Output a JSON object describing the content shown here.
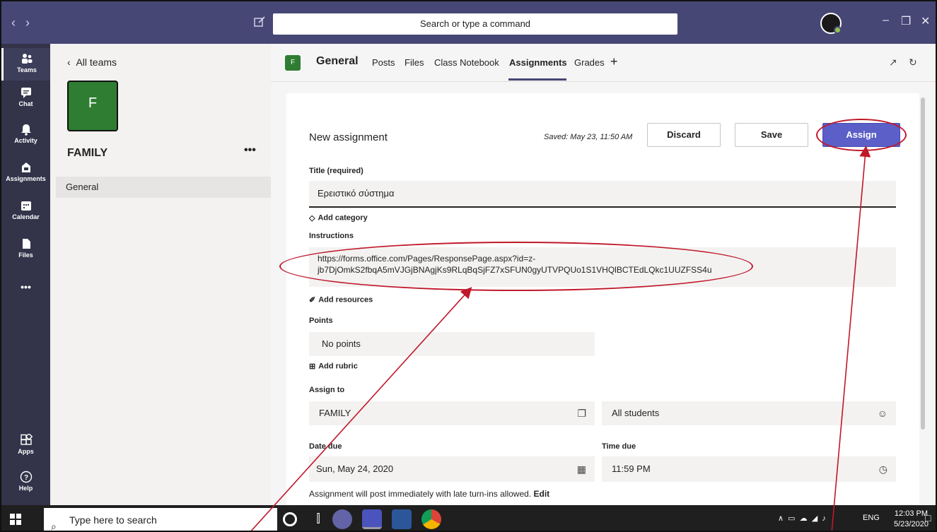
{
  "titlebar": {
    "search_placeholder": "Search or type a command",
    "nav_back_icon": "chevron-left-icon",
    "nav_forward_icon": "chevron-right-icon",
    "compose_icon": "compose-icon",
    "minimize": "–",
    "restore": "❐",
    "close": "✕"
  },
  "rail": {
    "items": [
      {
        "label": "Teams",
        "icon": "teams-icon"
      },
      {
        "label": "Chat",
        "icon": "chat-icon"
      },
      {
        "label": "Activity",
        "icon": "bell-icon"
      },
      {
        "label": "Assignments",
        "icon": "assignments-icon"
      },
      {
        "label": "Calendar",
        "icon": "calendar-icon"
      },
      {
        "label": "Files",
        "icon": "file-icon"
      },
      {
        "label": "•••",
        "icon": "more-icon"
      }
    ],
    "bottom": [
      {
        "label": "Apps",
        "icon": "apps-icon"
      },
      {
        "label": "Help",
        "icon": "help-icon"
      }
    ]
  },
  "teams_pane": {
    "back_label": "All teams",
    "team_initial": "F",
    "team_name": "FAMILY",
    "more": "•••",
    "channel": "General"
  },
  "channel_header": {
    "icon_initial": "F",
    "title": "General",
    "tabs": [
      "Posts",
      "Files",
      "Class Notebook",
      "Assignments",
      "Grades"
    ],
    "active_tab": "Assignments",
    "add_tab": "+"
  },
  "assignment": {
    "heading": "New assignment",
    "saved": "Saved: May 23, 11:50 AM",
    "discard_label": "Discard",
    "save_label": "Save",
    "assign_label": "Assign",
    "title_label": "Title (required)",
    "title_value": "Ερειστικό σύστημα",
    "add_category": "Add category",
    "instructions_label": "Instructions",
    "instructions_line1": "https://forms.office.com/Pages/ResponsePage.aspx?id=z-",
    "instructions_line2": "jb7DjOmkS2fbqA5mVJGjBNAgjKs9RLqBqSjFZ7xSFUN0gyUTVPQUo1S1VHQlBCTEdLQkc1UUZFSS4u",
    "add_resources": "Add resources",
    "points_label": "Points",
    "points_value": "No points",
    "add_rubric": "Add rubric",
    "assign_to_label": "Assign to",
    "assign_to_value": "FAMILY",
    "students_value": "All students",
    "date_due_label": "Date due",
    "date_due_value": "Sun, May 24, 2020",
    "time_due_label": "Time due",
    "time_due_value": "11:59 PM",
    "post_note": "Assignment will post immediately with late turn-ins allowed.",
    "edit_link": "Edit"
  },
  "taskbar": {
    "search_placeholder": "Type here to search",
    "lang": "ENG",
    "time": "12:03 PM",
    "date": "5/23/2020"
  },
  "colors": {
    "titlebar": "#464775",
    "rail": "#33344a",
    "team_tile": "#2e7d32",
    "assign_button": "#5b5fc7",
    "annotation": "#c0182a"
  }
}
